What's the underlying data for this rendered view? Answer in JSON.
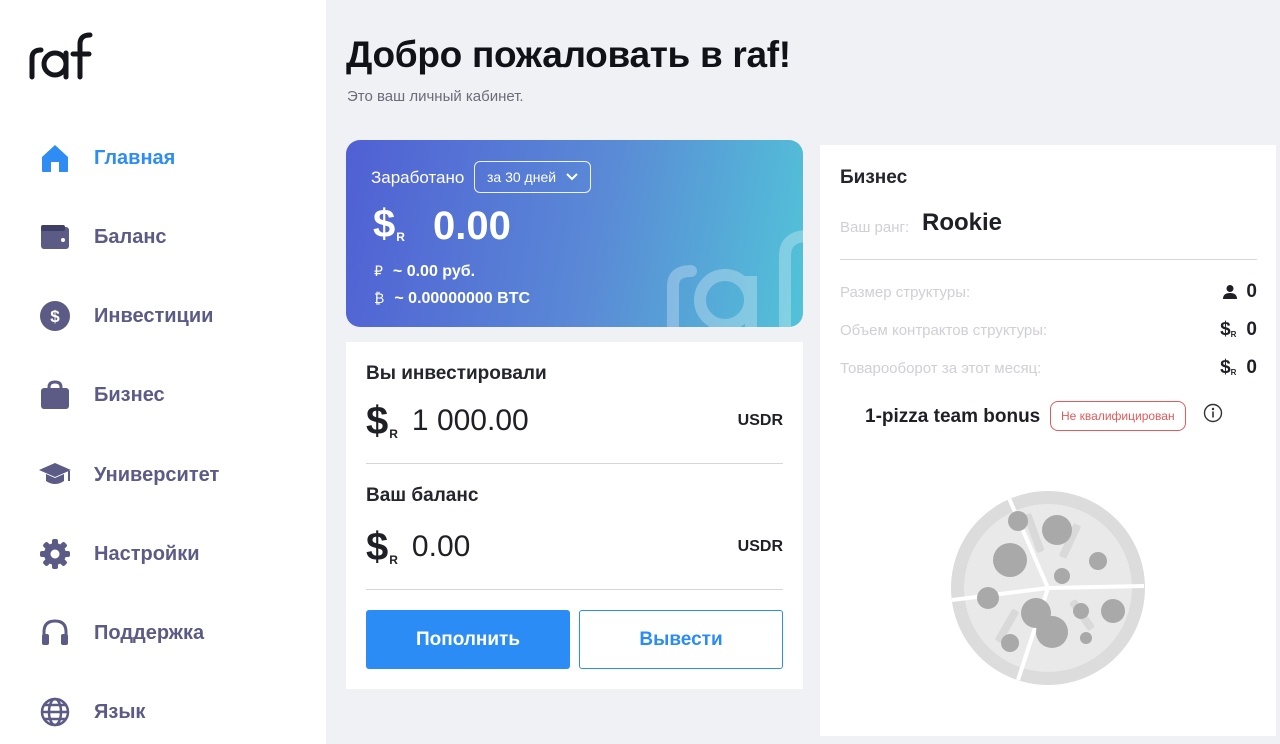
{
  "brand": {
    "logo_text": "raf",
    "accent": "#2e8cf4"
  },
  "sidebar": {
    "items": [
      {
        "label": "Главная",
        "icon": "home-icon",
        "active": true
      },
      {
        "label": "Баланс",
        "icon": "wallet-icon",
        "active": false
      },
      {
        "label": "Инвестиции",
        "icon": "dollar-coin-icon",
        "active": false
      },
      {
        "label": "Бизнес",
        "icon": "shopping-bag-icon",
        "active": false
      },
      {
        "label": "Университет",
        "icon": "graduation-cap-icon",
        "active": false
      },
      {
        "label": "Настройки",
        "icon": "gear-icon",
        "active": false
      },
      {
        "label": "Поддержка",
        "icon": "headset-icon",
        "active": false
      },
      {
        "label": "Язык",
        "icon": "globe-icon",
        "active": false
      }
    ]
  },
  "header": {
    "title": "Добро пожаловать в raf!",
    "subtitle": "Это ваш личный кабинет."
  },
  "earned": {
    "label": "Заработано",
    "period": "за 30 дней",
    "currency_symbol": "$",
    "currency_sub": "R",
    "amount": "0.00",
    "rub_symbol": "₽",
    "rub_value": "~ 0.00 руб.",
    "btc_symbol": "₿",
    "btc_value": "~ 0.00000000 BTC"
  },
  "investments": {
    "invested_title": "Вы инвестировали",
    "invested_value": "1 000.00",
    "invested_unit": "USDR",
    "balance_title": "Ваш баланс",
    "balance_value": "0.00",
    "balance_unit": "USDR",
    "currency_symbol": "$",
    "currency_sub": "R",
    "deposit_label": "Пополнить",
    "withdraw_label": "Вывести"
  },
  "business": {
    "title": "Бизнес",
    "rank_label": "Ваш ранг:",
    "rank_value": "Rookie",
    "stats": [
      {
        "label": "Размер структуры:",
        "value": "0",
        "icon": "user-icon"
      },
      {
        "label": "Объем контрактов структуры:",
        "value": "0",
        "icon": "usdr-icon"
      },
      {
        "label": "Товарооборот за этот месяц:",
        "value": "0",
        "icon": "usdr-icon"
      }
    ],
    "bonus_title": "1-pizza team bonus",
    "bonus_status": "Не квалифицирован",
    "status_color": "#e35a5a"
  }
}
